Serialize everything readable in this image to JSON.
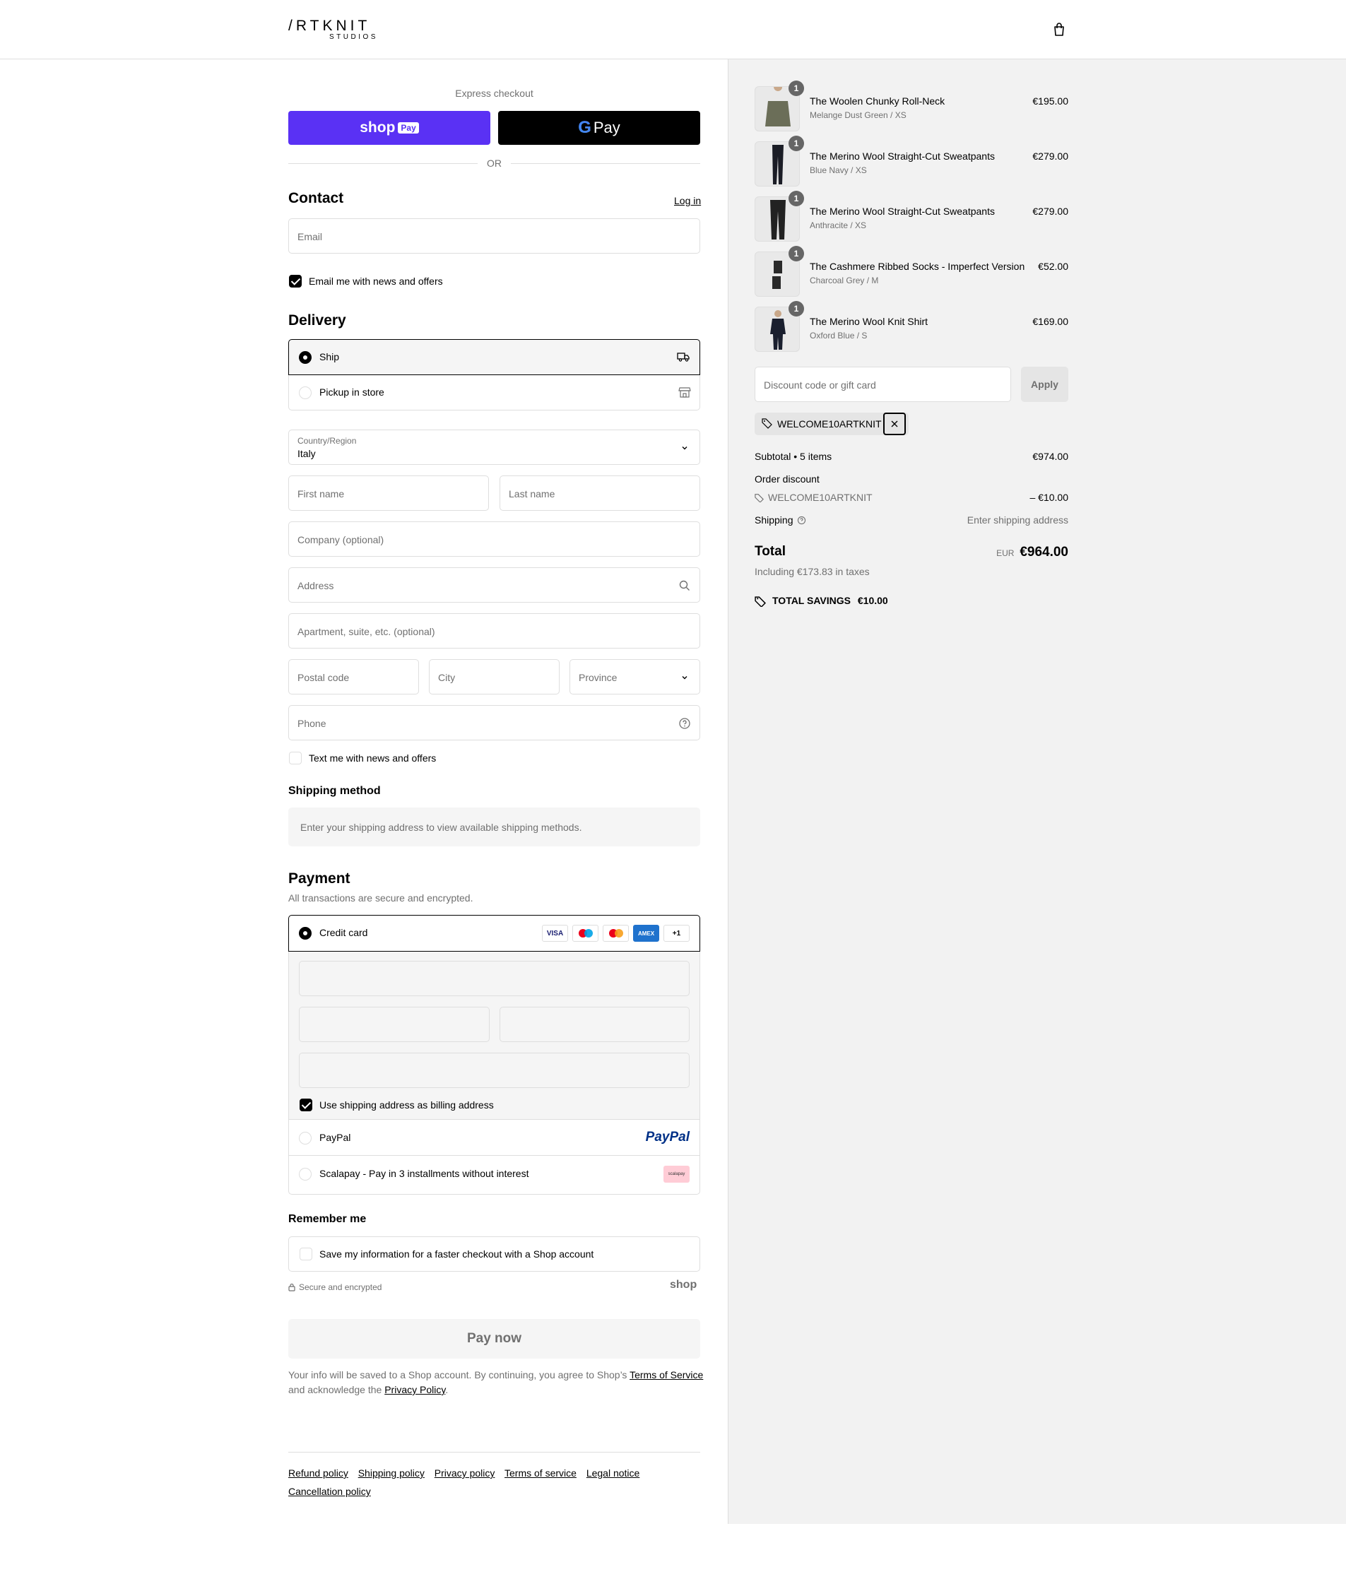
{
  "header": {
    "logo_main": "/RTKNIT",
    "logo_sub": "STUDIOS"
  },
  "express": {
    "title": "Express checkout",
    "shoppay_label": "shop",
    "shoppay_pay": "Pay",
    "gpay_g": "G",
    "gpay_label": "Pay",
    "or": "OR"
  },
  "contact": {
    "heading": "Contact",
    "login": "Log in",
    "email_placeholder": "Email",
    "newsletter_label": "Email me with news and offers",
    "newsletter_checked": true
  },
  "delivery": {
    "heading": "Delivery",
    "options": [
      {
        "label": "Ship",
        "selected": true
      },
      {
        "label": "Pickup in store",
        "selected": false
      }
    ],
    "country_label": "Country/Region",
    "country_value": "Italy",
    "first_name": "First name",
    "last_name": "Last name",
    "company": "Company (optional)",
    "address": "Address",
    "apartment": "Apartment, suite, etc. (optional)",
    "postal": "Postal code",
    "city": "City",
    "province": "Province",
    "phone": "Phone",
    "sms_label": "Text me with news and offers"
  },
  "shipping_method": {
    "heading": "Shipping method",
    "message": "Enter your shipping address to view available shipping methods."
  },
  "payment": {
    "heading": "Payment",
    "subtitle": "All transactions are secure and encrypted.",
    "credit_card": "Credit card",
    "cards": [
      "VISA",
      "",
      "",
      "AMEX",
      "+1"
    ],
    "billing_label": "Use shipping address as billing address",
    "paypal": "PayPal",
    "paypal_logo": "PayPal",
    "scalapay": "Scalapay - Pay in 3 installments without interest",
    "scalapay_logo": "scalapay"
  },
  "remember": {
    "heading": "Remember me",
    "save_label": "Save my information for a faster checkout with a Shop account",
    "secure": "Secure and encrypted",
    "shop_logo": "shop"
  },
  "pay_now": "Pay now",
  "legal": {
    "text1": "Your info will be saved to a Shop account. By continuing, you agree to Shop’s",
    "terms": "Terms of Service",
    "text2": "and acknowledge the",
    "privacy": "Privacy Policy",
    "text3": "."
  },
  "footer": {
    "links": [
      "Refund policy",
      "Shipping policy",
      "Privacy policy",
      "Terms of service",
      "Legal notice",
      "Cancellation policy"
    ]
  },
  "cart": {
    "items": [
      {
        "name": "The Woolen Chunky Roll-Neck",
        "variant": "Melange Dust Green / XS",
        "price": "€195.00",
        "qty": "1",
        "color": "#6b6e58"
      },
      {
        "name": "The Merino Wool Straight-Cut Sweatpants",
        "variant": "Blue Navy / XS",
        "price": "€279.00",
        "qty": "1",
        "color": "#1b1d26"
      },
      {
        "name": "The Merino Wool Straight-Cut Sweatpants",
        "variant": "Anthracite / XS",
        "price": "€279.00",
        "qty": "1",
        "color": "#222"
      },
      {
        "name": "The Cashmere Ribbed Socks - Imperfect Version",
        "variant": "Charcoal Grey / M",
        "price": "€52.00",
        "qty": "1",
        "color": "#2a2a2a"
      },
      {
        "name": "The Merino Wool Knit Shirt",
        "variant": "Oxford Blue / S",
        "price": "€169.00",
        "qty": "1",
        "color": "#1a1f2e"
      }
    ],
    "discount_placeholder": "Discount code or gift card",
    "apply": "Apply",
    "code": "WELCOME10ARTKNIT",
    "subtotal_label": "Subtotal • 5 items",
    "subtotal": "€974.00",
    "order_discount": "Order discount",
    "discount_code": "WELCOME10ARTKNIT",
    "discount_amount": "– €10.00",
    "shipping_label": "Shipping",
    "shipping_value": "Enter shipping address",
    "total_label": "Total",
    "currency": "EUR",
    "total": "€964.00",
    "taxes": "Including €173.83 in taxes",
    "savings_label": "TOTAL SAVINGS",
    "savings_value": "€10.00"
  },
  "colors": {
    "shoppay": "#5a31f4",
    "border": "#dedede",
    "panel": "#f2f2f2"
  }
}
